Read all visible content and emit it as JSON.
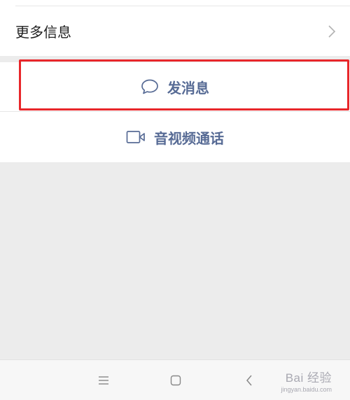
{
  "more_info": {
    "label": "更多信息",
    "icon": "chevron-right-icon"
  },
  "actions": {
    "send_message": {
      "label": "发消息",
      "icon": "chat-bubble-icon",
      "color": "#576b95"
    },
    "video_call": {
      "label": "音视频通话",
      "icon": "video-camera-icon",
      "color": "#576b95"
    }
  },
  "highlight": {
    "color": "#e8262a",
    "target": "send_message"
  },
  "system_nav": {
    "menu": "menu-icon",
    "home": "home-icon",
    "back": "back-icon"
  },
  "watermark": {
    "brand": "Bai 经验",
    "url": "jingyan.baidu.com"
  }
}
